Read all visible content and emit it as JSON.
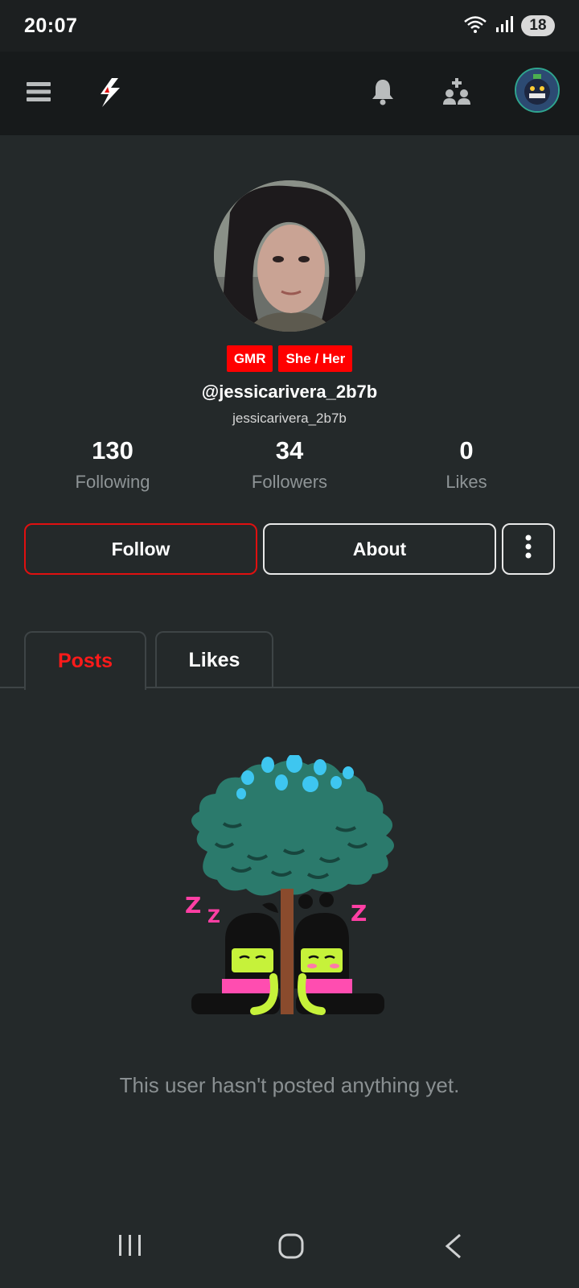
{
  "status_bar": {
    "time": "20:07",
    "battery": "18",
    "icons": [
      "wifi-icon",
      "signal-icon",
      "battery-icon"
    ]
  },
  "app_bar": {
    "icons": [
      "menu-icon",
      "logo-icon",
      "bell-icon",
      "people-icon",
      "user-avatar"
    ]
  },
  "profile": {
    "badges": [
      "GMR",
      "She / Her"
    ],
    "handle": "@jessicarivera_2b7b",
    "username": "jessicarivera_2b7b",
    "stats": {
      "following": {
        "value": "130",
        "label": "Following"
      },
      "followers": {
        "value": "34",
        "label": "Followers"
      },
      "likes": {
        "value": "0",
        "label": "Likes"
      }
    },
    "actions": {
      "follow_label": "Follow",
      "about_label": "About",
      "more_icon": "more-vertical-icon"
    }
  },
  "tabs": [
    {
      "label": "Posts",
      "active": true
    },
    {
      "label": "Likes",
      "active": false
    }
  ],
  "empty_state": {
    "message": "This user hasn't posted anything yet.",
    "illustration": "sleeping-under-tree-illustration"
  },
  "nav_bar": {
    "icons": [
      "recent-apps-icon",
      "home-icon",
      "back-icon"
    ]
  },
  "colors": {
    "accent": "#ff0000",
    "background": "#24292a",
    "app_bar": "#171a1b",
    "muted_text": "#8e9496"
  }
}
